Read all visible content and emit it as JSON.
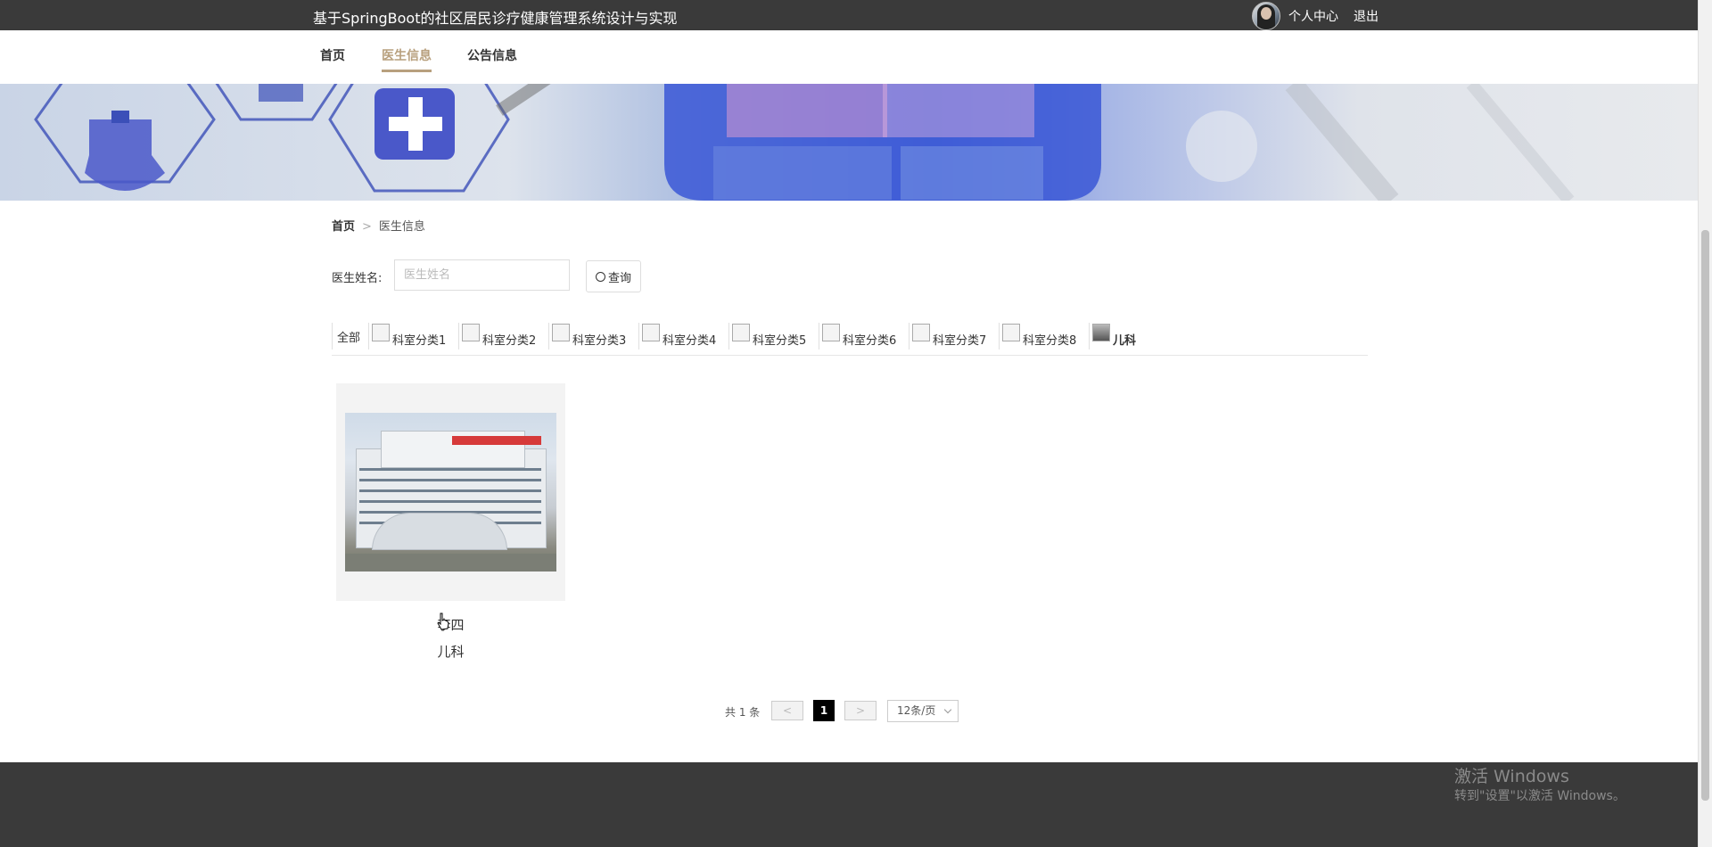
{
  "header": {
    "title": "基于SpringBoot的社区居民诊疗健康管理系统设计与实现",
    "user_center": "个人中心",
    "logout": "退出"
  },
  "nav": {
    "items": [
      {
        "label": "首页",
        "active": false
      },
      {
        "label": "医生信息",
        "active": true
      },
      {
        "label": "公告信息",
        "active": false
      }
    ],
    "accent_color": "#b8a07e"
  },
  "breadcrumb": {
    "home": "首页",
    "separator": ">",
    "current": "医生信息"
  },
  "search": {
    "label": "医生姓名:",
    "placeholder": "医生姓名",
    "value": "",
    "button_label": "查询",
    "button_icon": "search-icon"
  },
  "categories": {
    "all": "全部",
    "items": [
      "科室分类1",
      "科室分类2",
      "科室分类3",
      "科室分类4",
      "科室分类5",
      "科室分类6",
      "科室分类7",
      "科室分类8",
      "儿科"
    ]
  },
  "doctors": [
    {
      "name": "李四",
      "department": "儿科"
    }
  ],
  "pagination": {
    "total_text": "共 1 条",
    "prev": "<",
    "next": ">",
    "current_page": "1",
    "page_size": "12条/页"
  },
  "watermark": {
    "line1": "激活 Windows",
    "line2": "转到\"设置\"以激活 Windows。"
  },
  "colors": {
    "topbar_bg": "#3a3a3a",
    "footer_bg": "#3a3a3a",
    "active_page_bg": "#000000"
  }
}
